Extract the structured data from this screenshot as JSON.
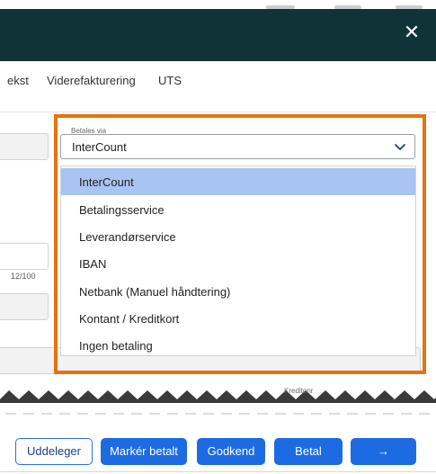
{
  "header": {
    "close_icon": "✕"
  },
  "tabs": [
    {
      "label": "ekst"
    },
    {
      "label": "Viderefakturering"
    },
    {
      "label": "UTS"
    }
  ],
  "counter": "12/100",
  "payment": {
    "label": "Betales via",
    "selected": "InterCount",
    "options": [
      {
        "label": "InterCount"
      },
      {
        "label": "Betalingsservice"
      },
      {
        "label": "Leverandørservice"
      },
      {
        "label": "IBAN"
      },
      {
        "label": "Netbank (Manuel håndtering)"
      },
      {
        "label": "Kontant / Kreditkort"
      },
      {
        "label": "Ingen betaling"
      }
    ]
  },
  "kreditor_label": "Kreditonr",
  "footer": {
    "buttons": [
      {
        "label": "Uddeleger"
      },
      {
        "label": "Markér betalt"
      },
      {
        "label": "Godkend"
      },
      {
        "label": "Betal"
      },
      {
        "label": "→"
      }
    ]
  },
  "colors": {
    "header": "#0f3337",
    "highlight": "#e5720e",
    "selected_option": "#a9c4f2",
    "primary_button": "#1d6be3"
  }
}
